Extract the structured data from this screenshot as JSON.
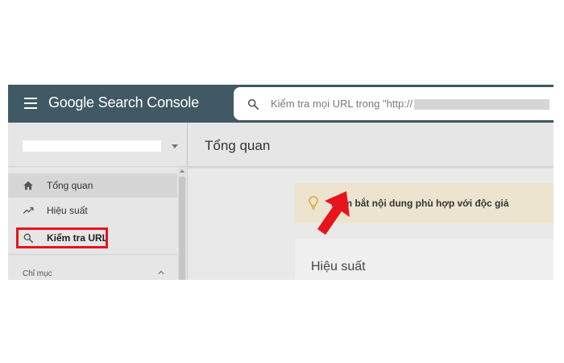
{
  "header": {
    "app_title": "Google Search Console",
    "search_placeholder": "Kiểm tra mọi URL trong \"http://",
    "property_url_redacted": true
  },
  "sidebar": {
    "property_name_redacted": true,
    "items": [
      {
        "label": "Tổng quan",
        "icon": "home-icon",
        "active": true
      },
      {
        "label": "Hiệu suất",
        "icon": "trending-up-icon",
        "active": false
      },
      {
        "label": "Kiểm tra URL",
        "icon": "search-icon",
        "active": false,
        "highlighted": true
      }
    ],
    "section_label": "Chỉ mục"
  },
  "main": {
    "page_title": "Tổng quan",
    "insight_card": {
      "text": "Nắm bắt nội dung phù hợp với độc giả",
      "icon": "lightbulb-icon"
    },
    "performance_card": {
      "title": "Hiệu suất"
    }
  },
  "annotations": {
    "highlight_color": "#e8141b",
    "arrow_color": "#e8141b",
    "arrow_target": "search-input"
  },
  "colors": {
    "topbar": "#405964",
    "sidebar_bg": "#e6e6e6",
    "insight_bg": "#ece4cf"
  }
}
